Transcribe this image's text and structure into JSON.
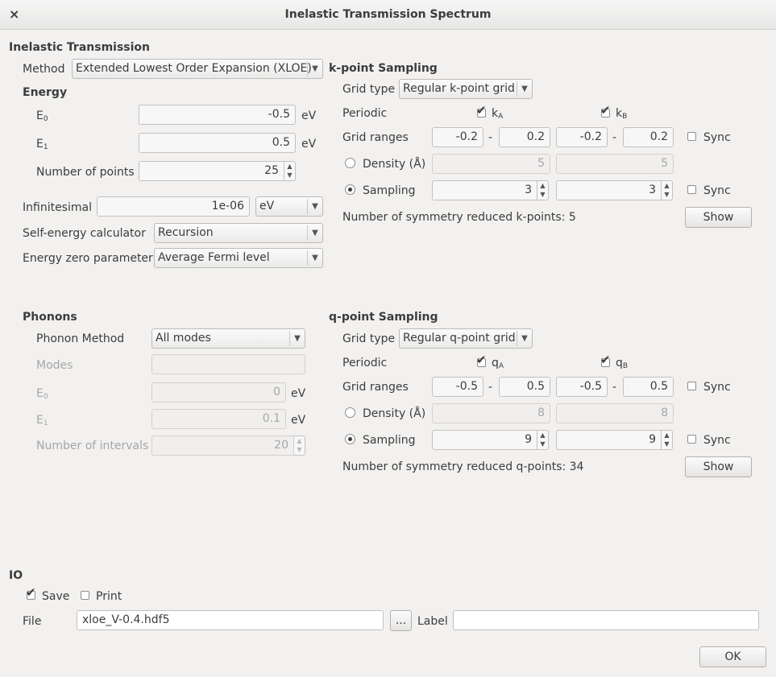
{
  "window": {
    "title": "Inelastic Transmission Spectrum",
    "close_glyph": "×"
  },
  "inelastic": {
    "header": "Inelastic Transmission",
    "method_label": "Method",
    "method_value": "Extended Lowest Order Expansion (XLOE)"
  },
  "energy": {
    "header": "Energy",
    "e0_label": "E",
    "e0_sub": "0",
    "e0_value": "-0.5",
    "e0_unit": "eV",
    "e1_label": "E",
    "e1_sub": "1",
    "e1_value": "0.5",
    "e1_unit": "eV",
    "points_label": "Number of points",
    "points_value": "25",
    "infinitesimal_label": "Infinitesimal",
    "infinitesimal_value": "1e-06",
    "infinitesimal_unit": "eV",
    "self_energy_label": "Self-energy calculator",
    "self_energy_value": "Recursion",
    "zero_label": "Energy zero parameter",
    "zero_value": "Average Fermi level"
  },
  "kpoint": {
    "header": "k-point Sampling",
    "grid_type_label": "Grid type",
    "grid_type_value": "Regular k-point grid",
    "periodic_label": "Periodic",
    "periodic_a": "k",
    "periodic_a_sub": "A",
    "periodic_a_checked": true,
    "periodic_b": "k",
    "periodic_b_sub": "B",
    "periodic_b_checked": true,
    "ranges_label": "Grid ranges",
    "range_a_min": "-0.2",
    "range_a_max": "0.2",
    "range_b_min": "-0.2",
    "range_b_max": "0.2",
    "dash": "-",
    "sync_label": "Sync",
    "density_label": "Density (Å)",
    "density_a": "5",
    "density_b": "5",
    "sampling_label": "Sampling",
    "sampling_a": "3",
    "sampling_b": "3",
    "reduced_text": "Number of symmetry reduced k-points: 5",
    "show_label": "Show"
  },
  "phonons": {
    "header": "Phonons",
    "method_label": "Phonon Method",
    "method_value": "All modes",
    "modes_label": "Modes",
    "modes_value": "",
    "e0_label": "E",
    "e0_sub": "0",
    "e0_value": "0",
    "e0_unit": "eV",
    "e1_label": "E",
    "e1_sub": "1",
    "e1_value": "0.1",
    "e1_unit": "eV",
    "intervals_label": "Number of intervals",
    "intervals_value": "20"
  },
  "qpoint": {
    "header": "q-point Sampling",
    "grid_type_label": "Grid type",
    "grid_type_value": "Regular q-point grid",
    "periodic_label": "Periodic",
    "periodic_a": "q",
    "periodic_a_sub": "A",
    "periodic_a_checked": true,
    "periodic_b": "q",
    "periodic_b_sub": "B",
    "periodic_b_checked": true,
    "ranges_label": "Grid ranges",
    "range_a_min": "-0.5",
    "range_a_max": "0.5",
    "range_b_min": "-0.5",
    "range_b_max": "0.5",
    "dash": "-",
    "sync_label": "Sync",
    "density_label": "Density (Å)",
    "density_a": "8",
    "density_b": "8",
    "sampling_label": "Sampling",
    "sampling_a": "9",
    "sampling_b": "9",
    "reduced_text": "Number of symmetry reduced q-points: 34",
    "show_label": "Show"
  },
  "io": {
    "header": "IO",
    "save_label": "Save",
    "save_checked": true,
    "print_label": "Print",
    "print_checked": false,
    "file_label": "File",
    "file_value": "xloe_V-0.4.hdf5",
    "browse_label": "...",
    "label_label": "Label",
    "label_value": ""
  },
  "ok_label": "OK"
}
